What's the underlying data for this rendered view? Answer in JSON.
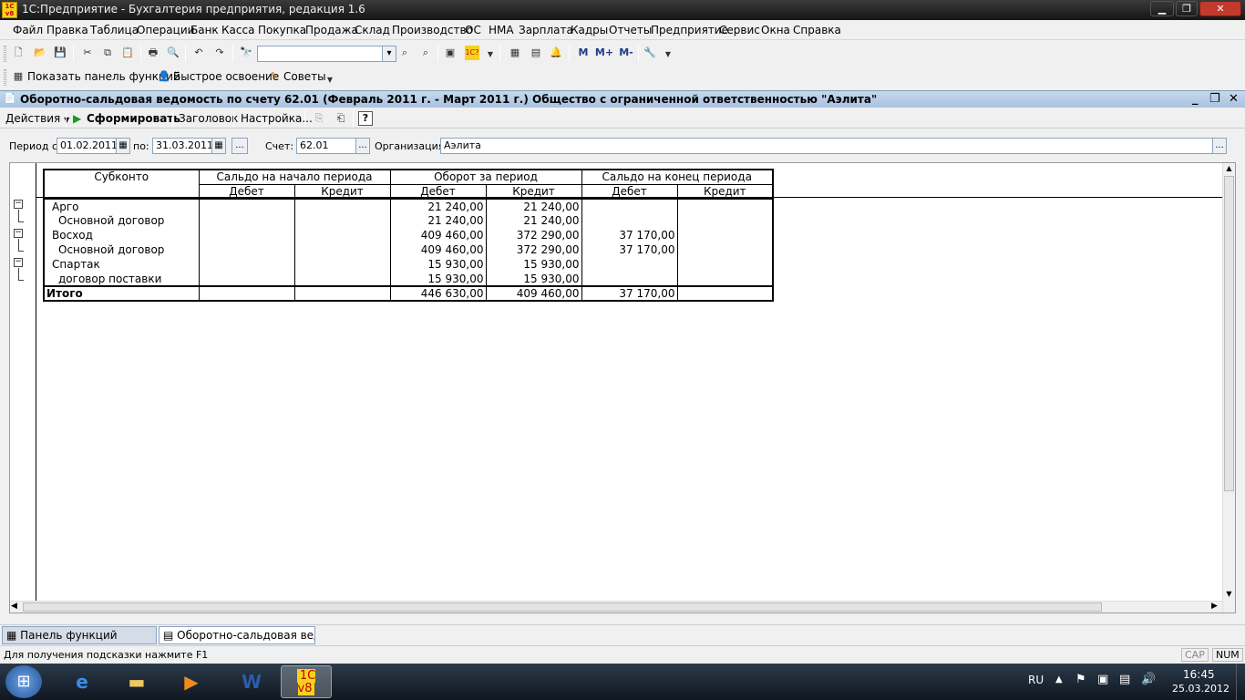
{
  "window": {
    "title": "1С:Предприятие - Бухгалтерия предприятия, редакция 1.6",
    "app_icon_text": "1С v8"
  },
  "menu": [
    "Файл",
    "Правка",
    "Таблица",
    "Операции",
    "Банк",
    "Касса",
    "Покупка",
    "Продажа",
    "Склад",
    "Производство",
    "ОС",
    "НМА",
    "Зарплата",
    "Кадры",
    "Отчеты",
    "Предприятие",
    "Сервис",
    "Окна",
    "Справка"
  ],
  "toolbar2": {
    "show_panel": "Показать панель функций",
    "quick_learn": "Быстрое освоение",
    "tips": "Советы",
    "memory": [
      "M",
      "M+",
      "M-"
    ]
  },
  "document": {
    "title": "Оборотно-сальдовая ведомость по счету 62.01 (Февраль 2011 г. - Март 2011 г.) Общество с ограниченной ответственностью \"Аэлита\""
  },
  "commands": {
    "actions": "Действия",
    "generate": "Сформировать",
    "header": "Заголовок",
    "settings": "Настройка...",
    "help": "?"
  },
  "params": {
    "period_from_label": "Период с:",
    "period_from": "01.02.2011",
    "period_to_label": "по:",
    "period_to": "31.03.2011",
    "account_label": "Счет:",
    "account": "62.01",
    "org_label": "Организация:",
    "org": "Аэлита",
    "ellipsis": "..."
  },
  "report": {
    "headers": {
      "subkonto": "Субконто",
      "opening": "Сальдо на начало периода",
      "turnover": "Оборот за период",
      "closing": "Сальдо на конец периода",
      "debit": "Дебет",
      "credit": "Кредит"
    },
    "rows": [
      {
        "name": "Арго",
        "indent": 0,
        "od": "",
        "oc": "",
        "td": "21 240,00",
        "tc": "21 240,00",
        "cd": "",
        "cc": ""
      },
      {
        "name": "Основной договор",
        "indent": 1,
        "od": "",
        "oc": "",
        "td": "21 240,00",
        "tc": "21 240,00",
        "cd": "",
        "cc": ""
      },
      {
        "name": "Восход",
        "indent": 0,
        "od": "",
        "oc": "",
        "td": "409 460,00",
        "tc": "372 290,00",
        "cd": "37 170,00",
        "cc": ""
      },
      {
        "name": "Основной договор",
        "indent": 1,
        "od": "",
        "oc": "",
        "td": "409 460,00",
        "tc": "372 290,00",
        "cd": "37 170,00",
        "cc": ""
      },
      {
        "name": "Спартак",
        "indent": 0,
        "od": "",
        "oc": "",
        "td": "15 930,00",
        "tc": "15 930,00",
        "cd": "",
        "cc": ""
      },
      {
        "name": "договор поставки",
        "indent": 1,
        "od": "",
        "oc": "",
        "td": "15 930,00",
        "tc": "15 930,00",
        "cd": "",
        "cc": ""
      }
    ],
    "total": {
      "name": "Итого",
      "od": "",
      "oc": "",
      "td": "446 630,00",
      "tc": "409 460,00",
      "cd": "37 170,00",
      "cc": ""
    }
  },
  "window_tabs": [
    "Панель функций",
    "Оборотно-сальдовая ведом..."
  ],
  "status": {
    "hint": "Для получения подсказки нажмите F1",
    "cap": "CAP",
    "num": "NUM"
  },
  "taskbar": {
    "lang": "RU",
    "time": "16:45",
    "date": "25.03.2012"
  }
}
